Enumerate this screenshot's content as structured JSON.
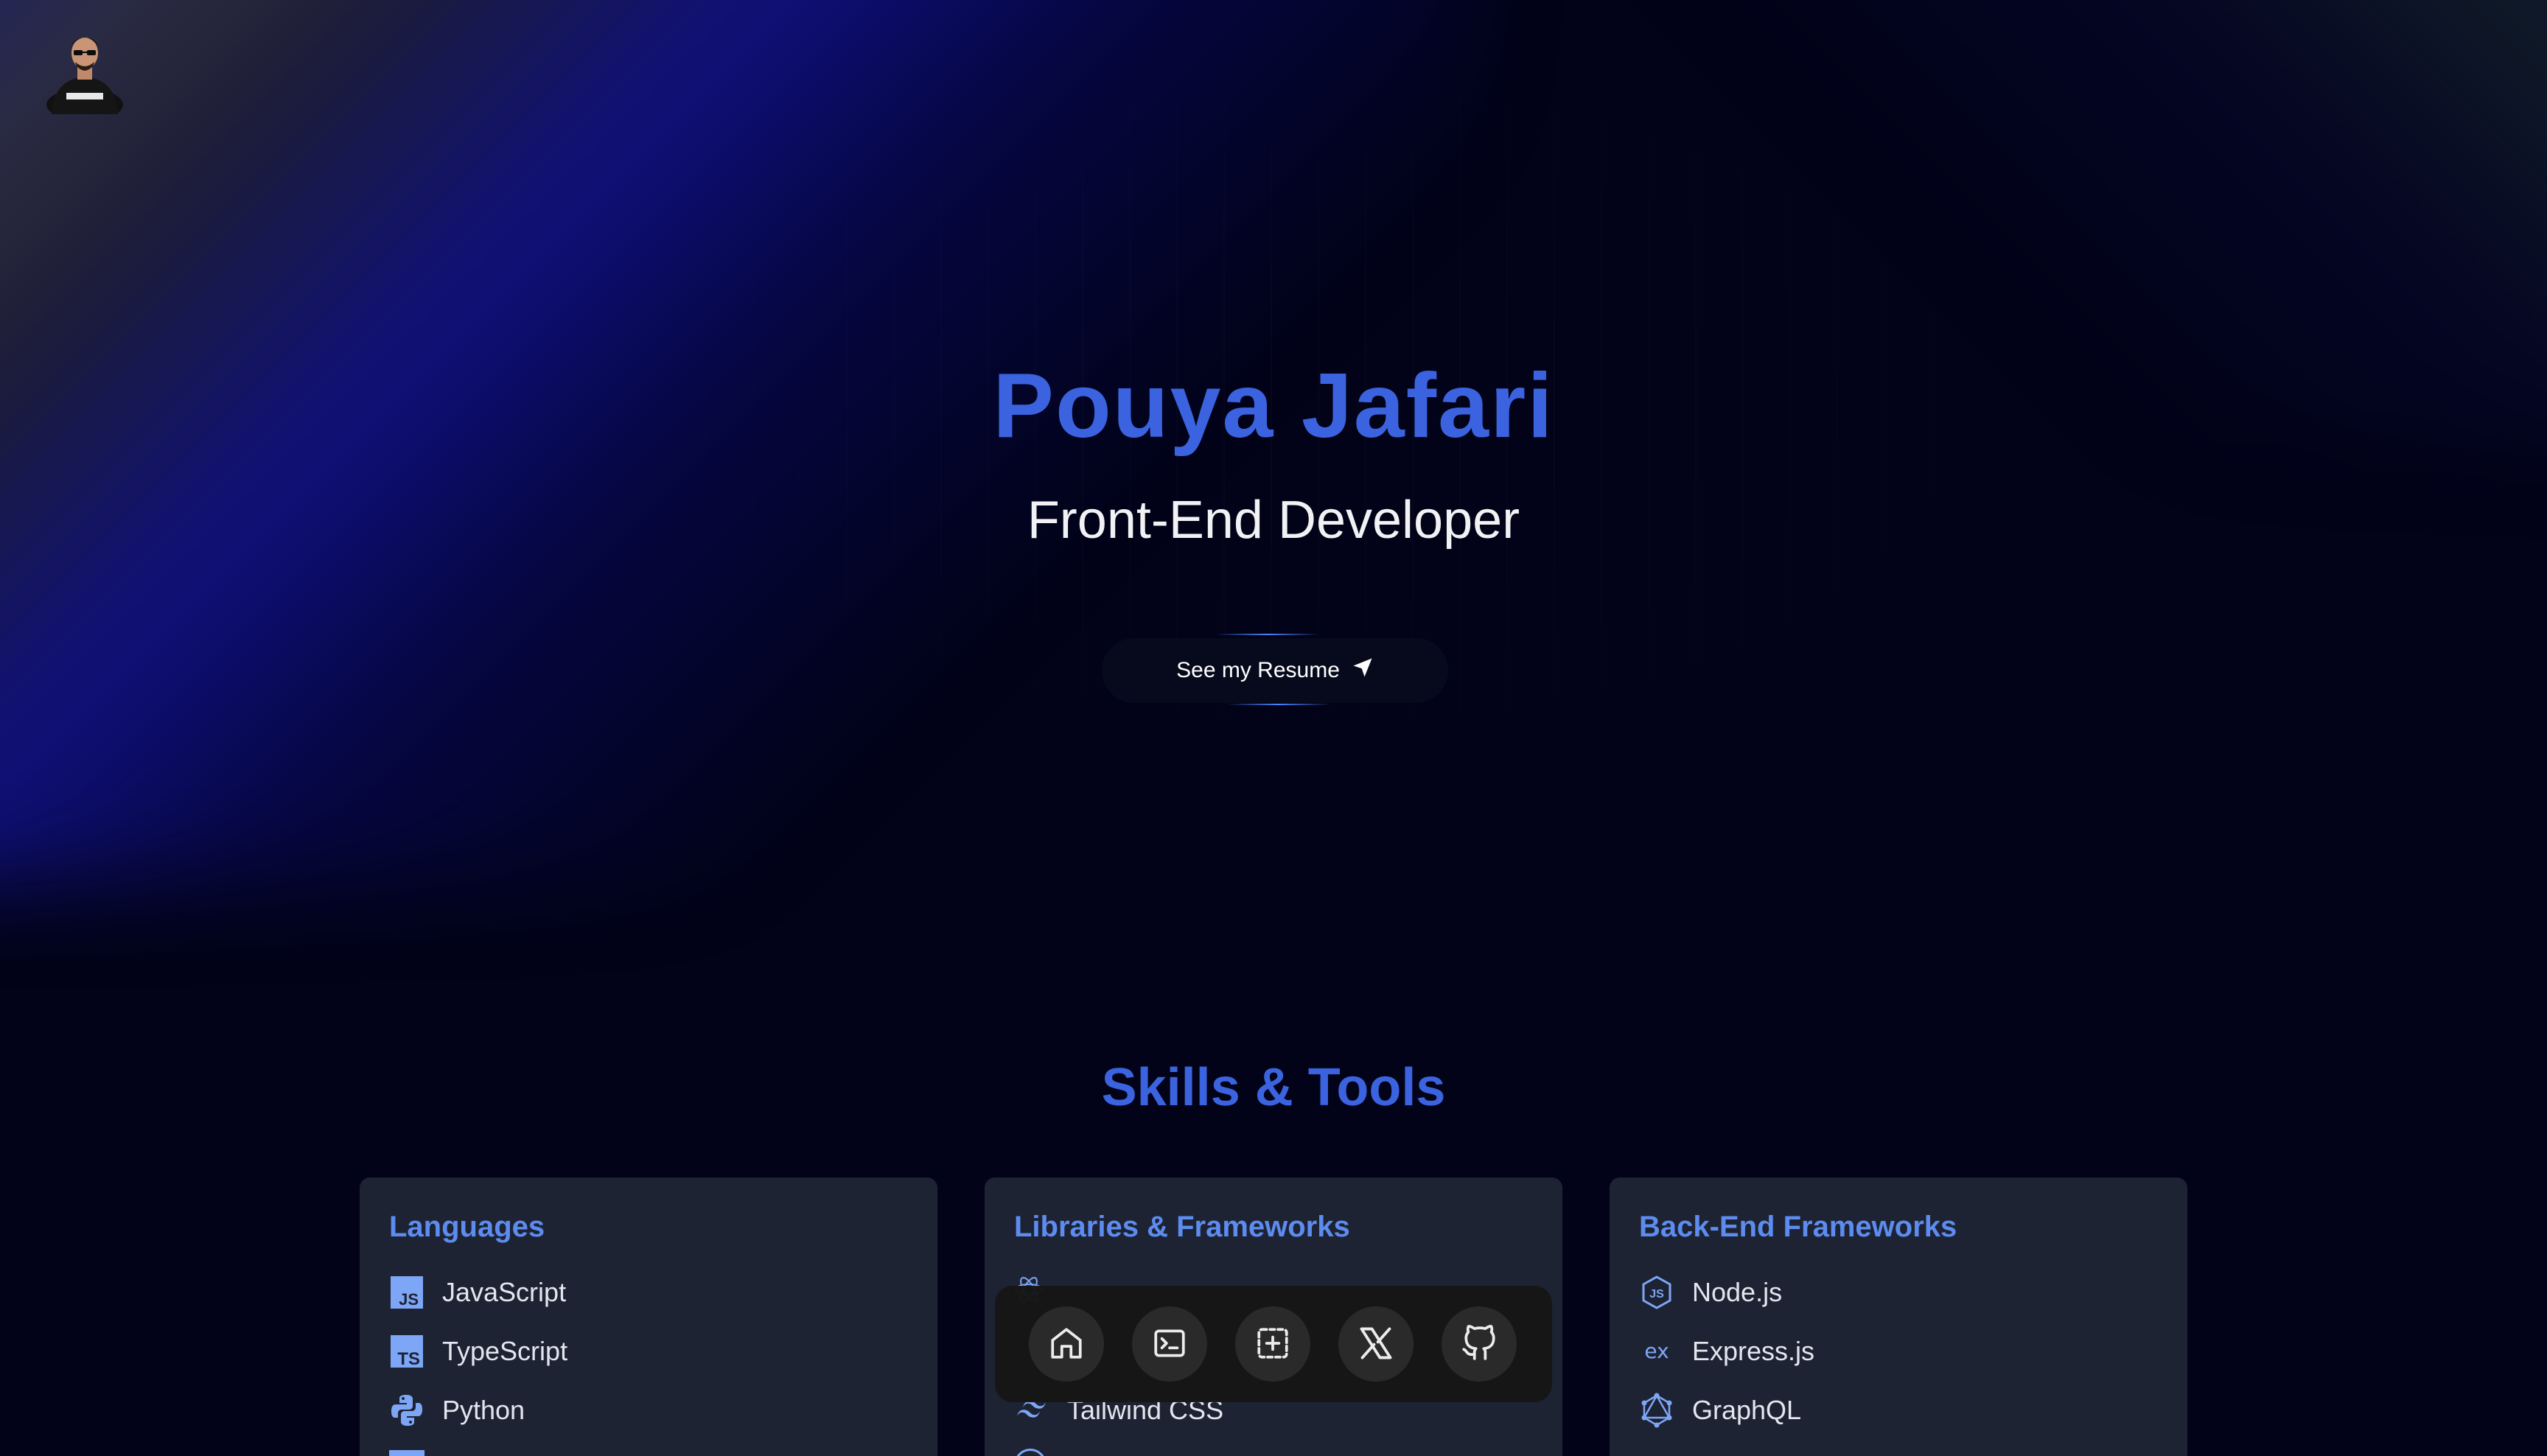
{
  "hero": {
    "name": "Pouya Jafari",
    "subtitle": "Front-End Developer",
    "resume_label": "See my Resume",
    "resume_icon": "send-icon"
  },
  "skills": {
    "title": "Skills & Tools",
    "cards": [
      {
        "title": "Languages",
        "items": [
          {
            "label": "JavaScript",
            "icon": "javascript-icon"
          },
          {
            "label": "TypeScript",
            "icon": "typescript-icon"
          },
          {
            "label": "Python",
            "icon": "python-icon"
          }
        ]
      },
      {
        "title": "Libraries & Frameworks",
        "items": [
          {
            "label": "Tailwind CSS",
            "icon": "tailwind-icon"
          }
        ]
      },
      {
        "title": "Back-End Frameworks",
        "items": [
          {
            "label": "Node.js",
            "icon": "nodejs-icon"
          },
          {
            "label": "Express.js",
            "icon": "express-icon"
          },
          {
            "label": "GraphQL",
            "icon": "graphql-icon"
          }
        ]
      }
    ]
  },
  "dock": {
    "items": [
      "home-icon",
      "terminal-icon",
      "focus-icon",
      "x-icon",
      "github-icon"
    ]
  },
  "colors": {
    "accent": "#3b63e0",
    "card_title": "#5d8cf0",
    "card_bg": "#1e2333",
    "background": "#020318"
  }
}
